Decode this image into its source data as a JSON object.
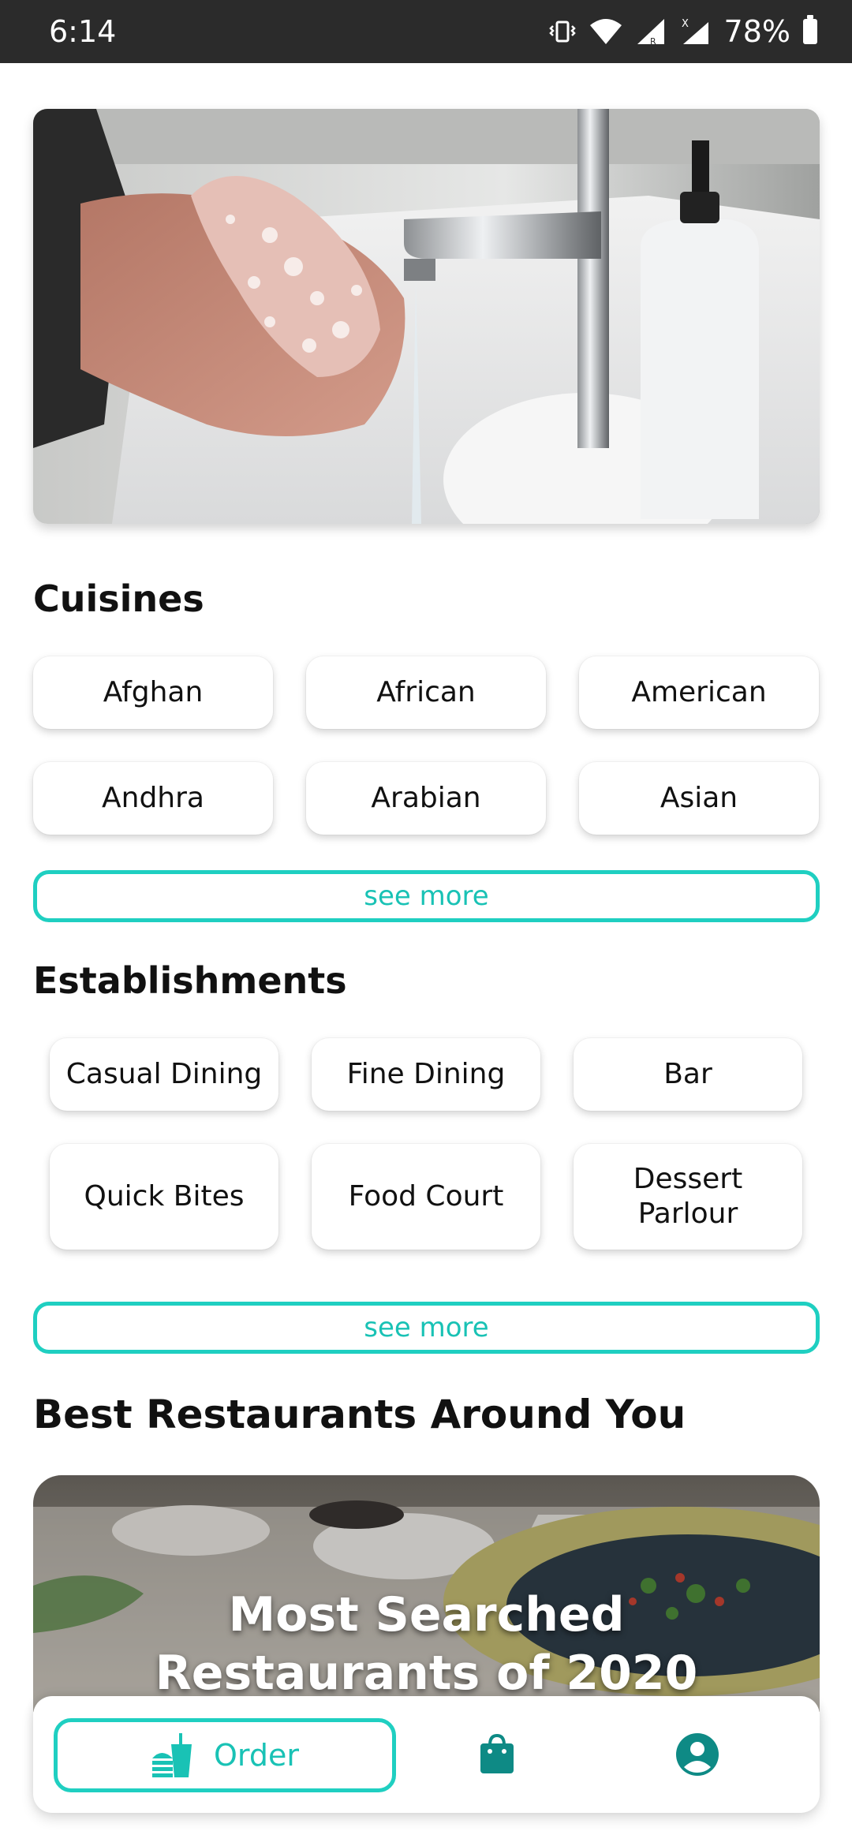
{
  "status_bar": {
    "time": "6:14",
    "battery": "78%"
  },
  "hero": {
    "icon": "hand-washing-photo"
  },
  "cuisines": {
    "title": "Cuisines",
    "items": [
      "Afghan",
      "African",
      "American",
      "Andhra",
      "Arabian",
      "Asian"
    ],
    "see_more": "see more"
  },
  "establishments": {
    "title": "Establishments",
    "items": [
      "Casual Dining",
      "Fine Dining",
      "Bar",
      "Quick Bites",
      "Food Court",
      "Dessert Parlour"
    ],
    "see_more": "see more"
  },
  "best": {
    "title": "Best Restaurants Around You",
    "banner_text": "Most Searched Restaurants of 2020"
  },
  "bottom_nav": {
    "order_label": "Order",
    "icons": [
      "food-order-icon",
      "shopping-bag-icon",
      "account-icon"
    ]
  },
  "colors": {
    "accent": "#1fcfc1",
    "accent_dark": "#0e8a85",
    "status_bar": "#2b2b2b"
  }
}
